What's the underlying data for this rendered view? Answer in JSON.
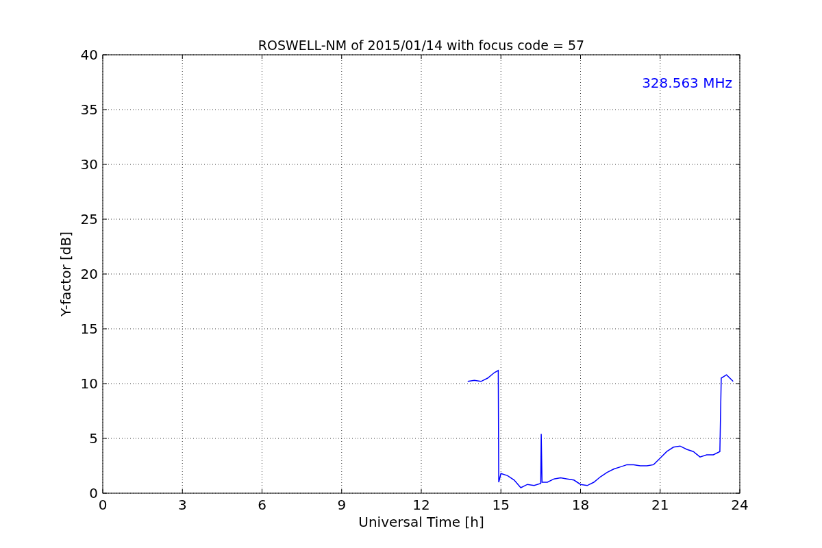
{
  "chart_data": {
    "type": "line",
    "title": "ROSWELL-NM of 2015/01/14 with focus code = 57",
    "xlabel": "Universal Time [h]",
    "ylabel": "Y-factor [dB]",
    "x": [
      13.75,
      14.0,
      14.25,
      14.5,
      14.75,
      14.9,
      14.92,
      15.0,
      15.25,
      15.5,
      15.75,
      16.0,
      16.25,
      16.5,
      16.52,
      16.55,
      16.75,
      17.0,
      17.25,
      17.5,
      17.75,
      18.0,
      18.25,
      18.5,
      18.75,
      19.0,
      19.25,
      19.5,
      19.75,
      20.0,
      20.25,
      20.5,
      20.75,
      21.0,
      21.25,
      21.5,
      21.75,
      22.0,
      22.25,
      22.5,
      22.75,
      23.0,
      23.25,
      23.3,
      23.5,
      23.75
    ],
    "series": [
      {
        "name": "328.563 MHz",
        "color": "#0000ff",
        "values": [
          10.2,
          10.3,
          10.2,
          10.5,
          11.0,
          11.2,
          1.0,
          1.8,
          1.6,
          1.2,
          0.5,
          0.8,
          0.7,
          0.9,
          5.4,
          1.0,
          1.0,
          1.3,
          1.4,
          1.3,
          1.2,
          0.8,
          0.7,
          1.0,
          1.5,
          1.9,
          2.2,
          2.4,
          2.6,
          2.6,
          2.5,
          2.5,
          2.6,
          3.2,
          3.8,
          4.2,
          4.3,
          4.0,
          3.8,
          3.3,
          3.5,
          3.5,
          3.8,
          10.5,
          10.8,
          10.2
        ]
      }
    ],
    "xlim": [
      0,
      24
    ],
    "ylim": [
      0,
      40
    ],
    "xticks": [
      0,
      3,
      6,
      9,
      12,
      15,
      18,
      21,
      24
    ],
    "yticks": [
      0,
      5,
      10,
      15,
      20,
      25,
      30,
      35,
      40
    ],
    "grid": true
  }
}
